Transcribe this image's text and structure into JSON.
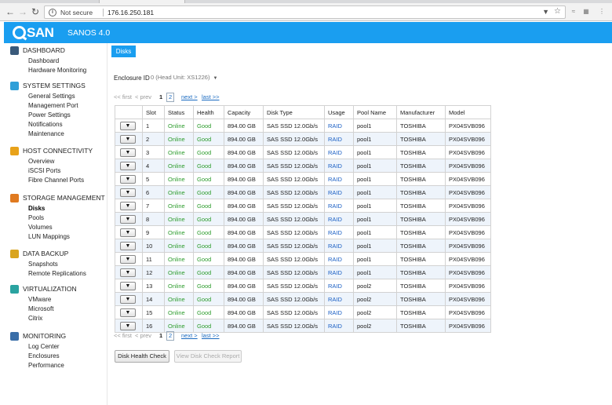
{
  "browser": {
    "security_label": "Not secure",
    "url": "176.16.250.181"
  },
  "app": {
    "brand": "SAN",
    "product": "SANOS 4.0"
  },
  "sidebar": {
    "groups": [
      {
        "label": "DASHBOARD",
        "icon": "dashboard-icon",
        "color": "#3a5a7a",
        "items": [
          "Dashboard",
          "Hardware Monitoring"
        ]
      },
      {
        "label": "SYSTEM SETTINGS",
        "icon": "settings-icon",
        "color": "#2f9fd8",
        "items": [
          "General Settings",
          "Management Port",
          "Power Settings",
          "Notifications",
          "Maintenance"
        ]
      },
      {
        "label": "HOST CONNECTIVITY",
        "icon": "host-icon",
        "color": "#e8a21a",
        "items": [
          "Overview",
          "iSCSI Ports",
          "Fibre Channel Ports"
        ]
      },
      {
        "label": "STORAGE MANAGEMENT",
        "icon": "storage-icon",
        "color": "#e07a20",
        "items": [
          "Disks",
          "Pools",
          "Volumes",
          "LUN Mappings"
        ]
      },
      {
        "label": "DATA BACKUP",
        "icon": "backup-icon",
        "color": "#d9a41e",
        "items": [
          "Snapshots",
          "Remote Replications"
        ]
      },
      {
        "label": "VIRTUALIZATION",
        "icon": "virtualization-icon",
        "color": "#2aa3a0",
        "items": [
          "VMware",
          "Microsoft",
          "Citrix"
        ]
      },
      {
        "label": "MONITORING",
        "icon": "monitoring-icon",
        "color": "#3a6ea8",
        "items": [
          "Log Center",
          "Enclosures",
          "Performance"
        ]
      }
    ],
    "active_item": "Disks"
  },
  "content": {
    "tab_label": "Disks",
    "enclosure_label": "Enclosure ID",
    "enclosure_value": "0 (Head Unit: XS1226)",
    "pager": {
      "first": "<< first",
      "prev": "< prev",
      "page1": "1",
      "page2": "2",
      "next": "next >",
      "last": "last >>"
    },
    "columns": [
      "Slot",
      "Status",
      "Health",
      "Capacity",
      "Disk Type",
      "Usage",
      "Pool Name",
      "Manufacturer",
      "Model"
    ],
    "row_button": "▼",
    "rows": [
      [
        "1",
        "Online",
        "Good",
        "894.00 GB",
        "SAS SSD 12.0Gb/s",
        "RAID",
        "pool1",
        "TOSHIBA",
        "PX04SVB096"
      ],
      [
        "2",
        "Online",
        "Good",
        "894.00 GB",
        "SAS SSD 12.0Gb/s",
        "RAID",
        "pool1",
        "TOSHIBA",
        "PX04SVB096"
      ],
      [
        "3",
        "Online",
        "Good",
        "894.00 GB",
        "SAS SSD 12.0Gb/s",
        "RAID",
        "pool1",
        "TOSHIBA",
        "PX04SVB096"
      ],
      [
        "4",
        "Online",
        "Good",
        "894.00 GB",
        "SAS SSD 12.0Gb/s",
        "RAID",
        "pool1",
        "TOSHIBA",
        "PX04SVB096"
      ],
      [
        "5",
        "Online",
        "Good",
        "894.00 GB",
        "SAS SSD 12.0Gb/s",
        "RAID",
        "pool1",
        "TOSHIBA",
        "PX04SVB096"
      ],
      [
        "6",
        "Online",
        "Good",
        "894.00 GB",
        "SAS SSD 12.0Gb/s",
        "RAID",
        "pool1",
        "TOSHIBA",
        "PX04SVB096"
      ],
      [
        "7",
        "Online",
        "Good",
        "894.00 GB",
        "SAS SSD 12.0Gb/s",
        "RAID",
        "pool1",
        "TOSHIBA",
        "PX04SVB096"
      ],
      [
        "8",
        "Online",
        "Good",
        "894.00 GB",
        "SAS SSD 12.0Gb/s",
        "RAID",
        "pool1",
        "TOSHIBA",
        "PX04SVB096"
      ],
      [
        "9",
        "Online",
        "Good",
        "894.00 GB",
        "SAS SSD 12.0Gb/s",
        "RAID",
        "pool1",
        "TOSHIBA",
        "PX04SVB096"
      ],
      [
        "10",
        "Online",
        "Good",
        "894.00 GB",
        "SAS SSD 12.0Gb/s",
        "RAID",
        "pool1",
        "TOSHIBA",
        "PX04SVB096"
      ],
      [
        "11",
        "Online",
        "Good",
        "894.00 GB",
        "SAS SSD 12.0Gb/s",
        "RAID",
        "pool1",
        "TOSHIBA",
        "PX04SVB096"
      ],
      [
        "12",
        "Online",
        "Good",
        "894.00 GB",
        "SAS SSD 12.0Gb/s",
        "RAID",
        "pool1",
        "TOSHIBA",
        "PX04SVB096"
      ],
      [
        "13",
        "Online",
        "Good",
        "894.00 GB",
        "SAS SSD 12.0Gb/s",
        "RAID",
        "pool2",
        "TOSHIBA",
        "PX04SVB096"
      ],
      [
        "14",
        "Online",
        "Good",
        "894.00 GB",
        "SAS SSD 12.0Gb/s",
        "RAID",
        "pool2",
        "TOSHIBA",
        "PX04SVB096"
      ],
      [
        "15",
        "Online",
        "Good",
        "894.00 GB",
        "SAS SSD 12.0Gb/s",
        "RAID",
        "pool2",
        "TOSHIBA",
        "PX04SVB096"
      ],
      [
        "16",
        "Online",
        "Good",
        "894.00 GB",
        "SAS SSD 12.0Gb/s",
        "RAID",
        "pool2",
        "TOSHIBA",
        "PX04SVB096"
      ]
    ],
    "buttons": {
      "health_check": "Disk Health Check",
      "view_report": "View Disk Check Report"
    }
  },
  "colors": {
    "brand_blue": "#1a9ef0",
    "online_green": "#2e9d2e",
    "link_blue": "#1a5fc4"
  }
}
